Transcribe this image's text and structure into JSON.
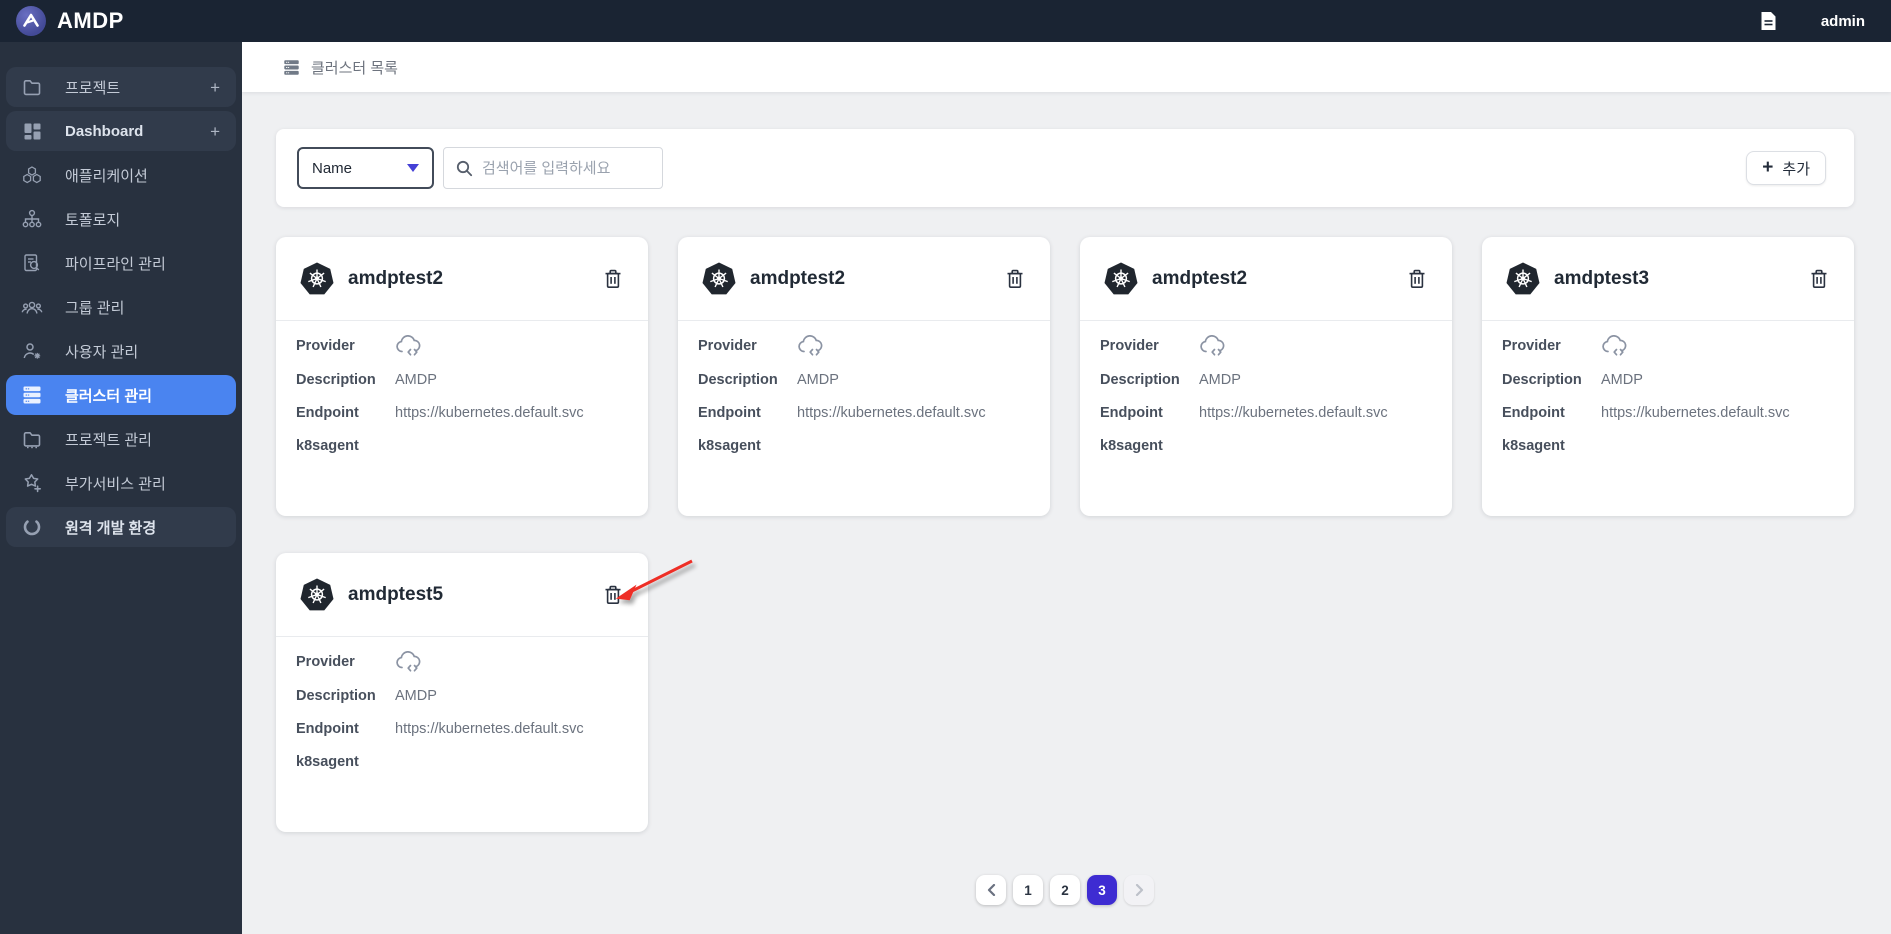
{
  "topbar": {
    "brand": "AMDP",
    "user": "admin"
  },
  "sidebar": {
    "items": [
      {
        "label": "프로젝트",
        "icon": "folder-icon",
        "has_plus": true,
        "boxed": true,
        "active": false
      },
      {
        "label": "Dashboard",
        "icon": "dashboard-grid-icon",
        "has_plus": true,
        "boxed": true,
        "active": false
      },
      {
        "label": "애플리케이션",
        "icon": "honeycomb-icon",
        "has_plus": false,
        "boxed": false,
        "active": false
      },
      {
        "label": "토폴로지",
        "icon": "topology-icon",
        "has_plus": false,
        "boxed": false,
        "active": false
      },
      {
        "label": "파이프라인 관리",
        "icon": "document-search-icon",
        "has_plus": false,
        "boxed": false,
        "active": false
      },
      {
        "label": "그룹 관리",
        "icon": "people-group-icon",
        "has_plus": false,
        "boxed": false,
        "active": false
      },
      {
        "label": "사용자 관리",
        "icon": "user-gear-icon",
        "has_plus": false,
        "boxed": false,
        "active": false
      },
      {
        "label": "클러스터 관리",
        "icon": "server-stack-icon",
        "has_plus": false,
        "boxed": false,
        "active": true
      },
      {
        "label": "프로젝트 관리",
        "icon": "folder-dots-icon",
        "has_plus": false,
        "boxed": false,
        "active": false
      },
      {
        "label": "부가서비스 관리",
        "icon": "addon-plus-icon",
        "has_plus": false,
        "boxed": false,
        "active": false
      },
      {
        "label": "원격 개발 환경",
        "icon": "loader-circle-icon",
        "has_plus": false,
        "boxed": true,
        "active": false
      }
    ]
  },
  "breadcrumb": {
    "label": "클러스터 목록",
    "icon": "server-stack-icon"
  },
  "filter": {
    "dropdown_value": "Name",
    "search_placeholder": "검색어를 입력하세요",
    "add_label": "추가"
  },
  "card_common": {
    "title_icon": "kubernetes-icon",
    "delete_icon": "trash-icon",
    "provider_icon": "cloud-code-icon"
  },
  "cards": [
    {
      "title": "amdptest2",
      "fields": [
        {
          "label": "Provider",
          "value": "",
          "icon": "cloud-code-icon"
        },
        {
          "label": "Description",
          "value": "AMDP",
          "icon": ""
        },
        {
          "label": "Endpoint",
          "value": "https://kubernetes.default.svc",
          "icon": ""
        },
        {
          "label": "k8sagent",
          "value": "",
          "icon": ""
        }
      ]
    },
    {
      "title": "amdptest2",
      "fields": [
        {
          "label": "Provider",
          "value": "",
          "icon": "cloud-code-icon"
        },
        {
          "label": "Description",
          "value": "AMDP",
          "icon": ""
        },
        {
          "label": "Endpoint",
          "value": "https://kubernetes.default.svc",
          "icon": ""
        },
        {
          "label": "k8sagent",
          "value": "",
          "icon": ""
        }
      ]
    },
    {
      "title": "amdptest2",
      "fields": [
        {
          "label": "Provider",
          "value": "",
          "icon": "cloud-code-icon"
        },
        {
          "label": "Description",
          "value": "AMDP",
          "icon": ""
        },
        {
          "label": "Endpoint",
          "value": "https://kubernetes.default.svc",
          "icon": ""
        },
        {
          "label": "k8sagent",
          "value": "",
          "icon": ""
        }
      ]
    },
    {
      "title": "amdptest3",
      "fields": [
        {
          "label": "Provider",
          "value": "",
          "icon": "cloud-code-icon"
        },
        {
          "label": "Description",
          "value": "AMDP",
          "icon": ""
        },
        {
          "label": "Endpoint",
          "value": "https://kubernetes.default.svc",
          "icon": ""
        },
        {
          "label": "k8sagent",
          "value": "",
          "icon": ""
        }
      ]
    },
    {
      "title": "amdptest5",
      "fields": [
        {
          "label": "Provider",
          "value": "",
          "icon": "cloud-code-icon"
        },
        {
          "label": "Description",
          "value": "AMDP",
          "icon": ""
        },
        {
          "label": "Endpoint",
          "value": "https://kubernetes.default.svc",
          "icon": ""
        },
        {
          "label": "k8sagent",
          "value": "",
          "icon": ""
        }
      ]
    }
  ],
  "annotation": {
    "type": "red-arrow",
    "points_at": "delete button of card amdptest5"
  },
  "pagination": {
    "pages": [
      "1",
      "2",
      "3"
    ],
    "active": "3",
    "prev_enabled": true,
    "next_enabled": false
  },
  "colors": {
    "topbar_bg": "#1a2433",
    "sidebar_bg": "#28313f",
    "sidebar_active": "#4a84f0",
    "pagination_active": "#3e2cd2",
    "arrow_red": "#ee2f28",
    "content_bg": "#eff0f2"
  }
}
